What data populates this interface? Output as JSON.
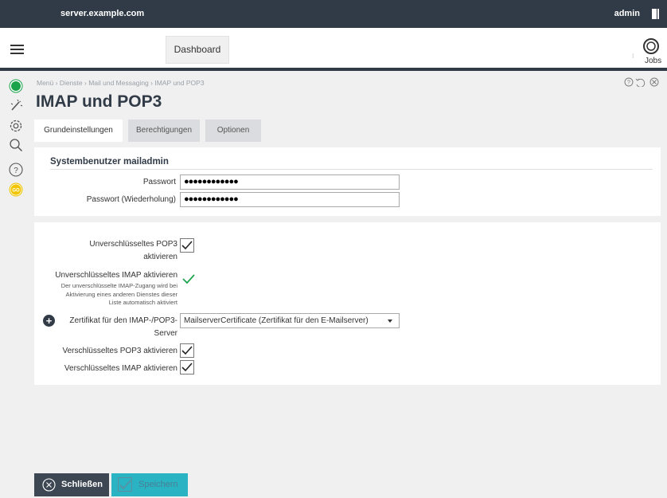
{
  "topbar": {
    "host": "server.example.com",
    "user": "admin"
  },
  "header": {
    "dashboard_tab": "Dashboard",
    "jobs_label": "Jobs",
    "jobs_sep": "⁝"
  },
  "breadcrumb": "Menü › Dienste › Mail und Messaging › IMAP und POP3",
  "page_title": "IMAP und POP3",
  "tabs": [
    {
      "label": "Grundeinstellungen",
      "active": true
    },
    {
      "label": "Berechtigungen",
      "active": false
    },
    {
      "label": "Optionen",
      "active": false
    }
  ],
  "system_user": {
    "title": "Systembenutzer mailadmin",
    "password_label": "Passwort",
    "password_value": "●●●●●●●●●●●●",
    "password_repeat_label": "Passwort (Wiederholung)",
    "password_repeat_value": "●●●●●●●●●●●●"
  },
  "settings": {
    "pop3_plain_label": "Unverschlüsseltes POP3 aktivieren",
    "pop3_plain_checked": true,
    "imap_plain_label": "Unverschlüsseltes IMAP aktivieren",
    "imap_plain_hint": "Der unverschlüsselte IMAP-Zugang wird bei Aktivierung eines anderen Dienstes dieser Liste automatisch aktiviert",
    "imap_plain_checked": true,
    "cert_label": "Zertifikat für den IMAP-/POP3-Server",
    "cert_value": "MailserverCertificate (Zertifikat für den E-Mailserver)",
    "pop3_ssl_label": "Verschlüsseltes POP3 aktivieren",
    "pop3_ssl_checked": true,
    "imap_ssl_label": "Verschlüsseltes IMAP aktivieren",
    "imap_ssl_checked": true
  },
  "footer": {
    "close_label": "Schließen",
    "save_label": "Speichern"
  },
  "colors": {
    "topbar": "#313b47",
    "accent": "#2ab3c3",
    "status_green": "#1aa34a",
    "go_yellow": "#f2c500"
  },
  "rail_icons": [
    "status-icon",
    "wizard-icon",
    "settings-icon",
    "search-icon",
    "help-icon",
    "go-icon"
  ]
}
